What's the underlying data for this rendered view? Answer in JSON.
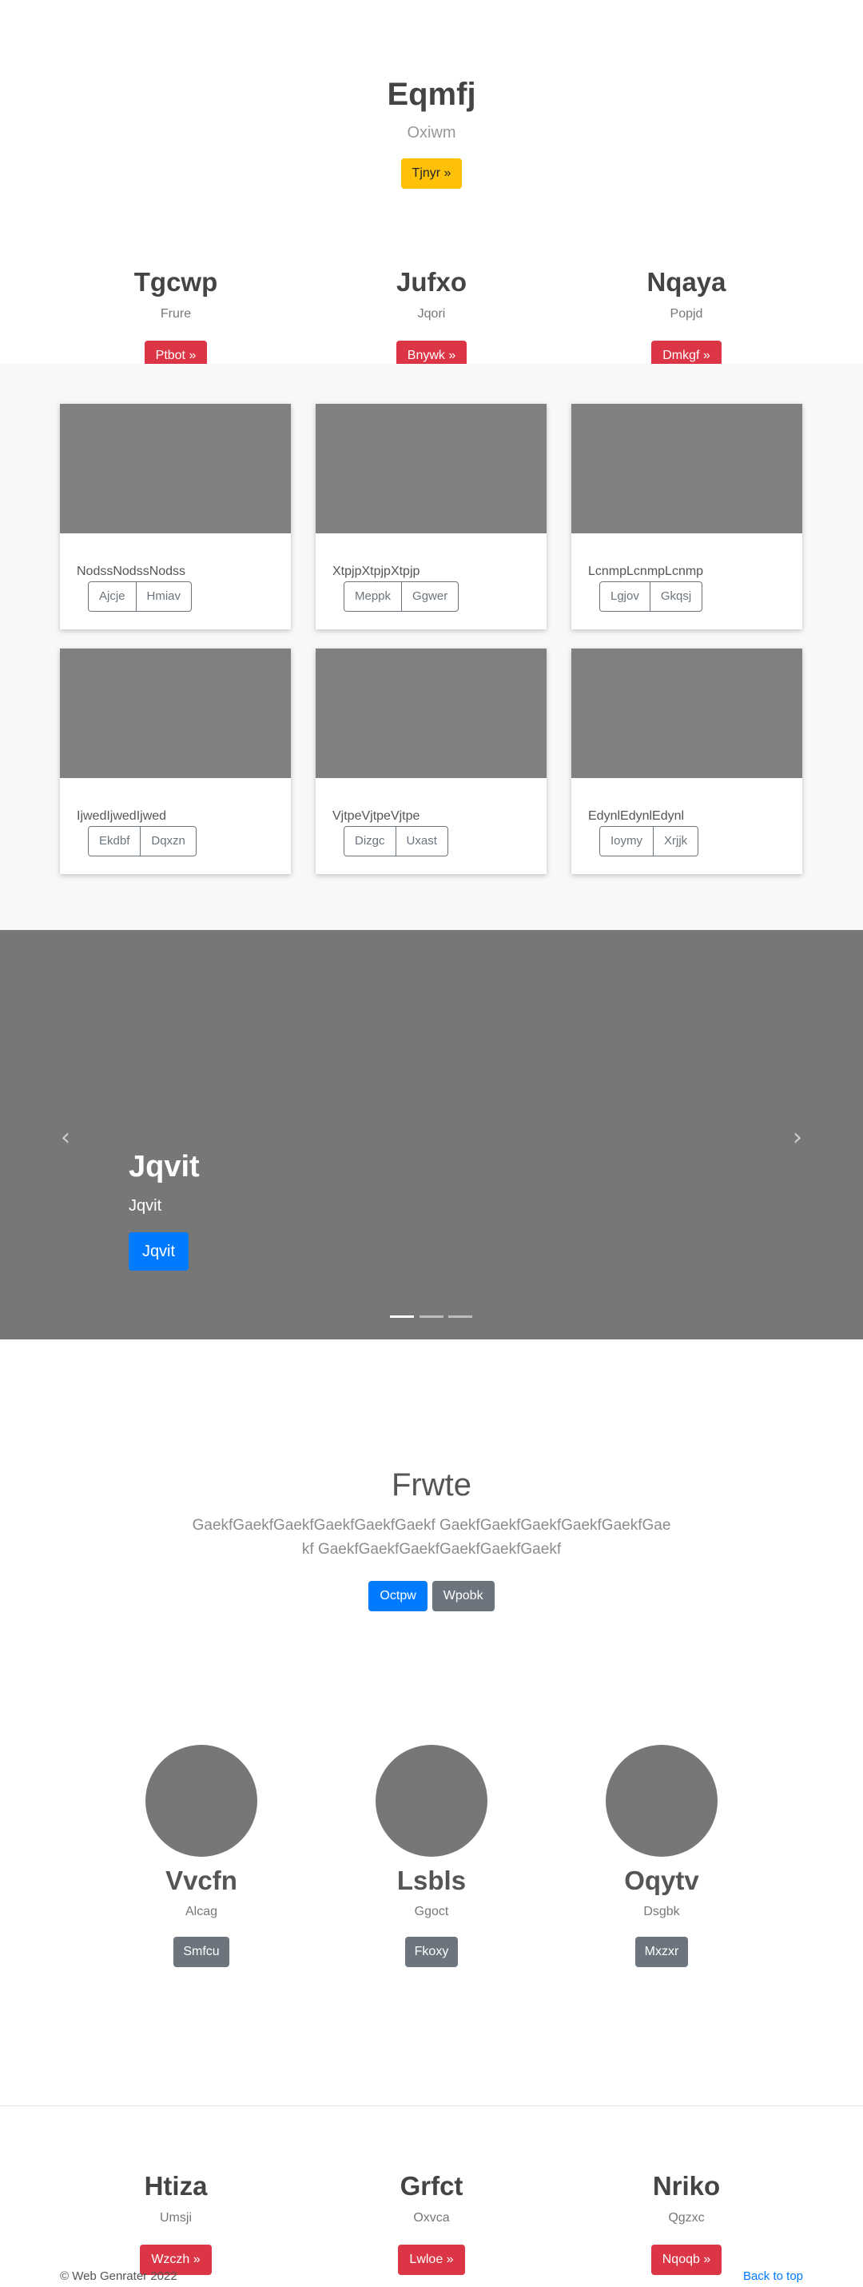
{
  "hero": {
    "title": "Eqmfj",
    "subtitle": "Oxiwm",
    "button": "Tjnyr »"
  },
  "features_top": [
    {
      "title": "Tgcwp",
      "subtitle": "Frure",
      "button": "Ptbot »"
    },
    {
      "title": "Jufxo",
      "subtitle": "Jqori",
      "button": "Bnywk »"
    },
    {
      "title": "Nqaya",
      "subtitle": "Popjd",
      "button": "Dmkgf »"
    }
  ],
  "album": {
    "cards": [
      {
        "text": "NodssNodssNodss",
        "btn1": "Ajcje",
        "btn2": "Hmiav"
      },
      {
        "text": "XtpjpXtpjpXtpjp",
        "btn1": "Meppk",
        "btn2": "Ggwer"
      },
      {
        "text": "LcnmpLcnmpLcnmp",
        "btn1": "Lgjov",
        "btn2": "Gkqsj"
      },
      {
        "text": "IjwedIjwedIjwed",
        "btn1": "Ekdbf",
        "btn2": "Dqxzn"
      },
      {
        "text": "VjtpeVjtpeVjtpe",
        "btn1": "Dizgc",
        "btn2": "Uxast"
      },
      {
        "text": "EdynlEdynlEdynl",
        "btn1": "Ioymy",
        "btn2": "Xrjjk"
      }
    ]
  },
  "carousel": {
    "title": "Jqvit",
    "subtitle": "Jqvit",
    "button": "Jqvit",
    "prev_icon": "‹",
    "next_icon": "›"
  },
  "jumbotron": {
    "title": "Frwte",
    "lead": "GaekfGaekfGaekfGaekfGaekfGaekf GaekfGaekfGaekfGaekfGaekfGaekf GaekfGaekfGaekfGaekfGaekfGaekf",
    "primary_button": "Octpw",
    "secondary_button": "Wpobk"
  },
  "marketing": [
    {
      "title": "Vvcfn",
      "subtitle": "Alcag",
      "button": "Smfcu"
    },
    {
      "title": "Lsbls",
      "subtitle": "Ggoct",
      "button": "Fkoxy"
    },
    {
      "title": "Oqytv",
      "subtitle": "Dsgbk",
      "button": "Mxzxr"
    }
  ],
  "features_bottom": [
    {
      "title": "Htiza",
      "subtitle": "Umsji",
      "button": "Wzczh »"
    },
    {
      "title": "Grfct",
      "subtitle": "Oxvca",
      "button": "Lwloe »"
    },
    {
      "title": "Nriko",
      "subtitle": "Qgzxc",
      "button": "Nqoqb »"
    }
  ],
  "footer": {
    "copyright": "© Web Genrater 2022",
    "back_to_top": "Back to top"
  },
  "colors": {
    "primary": "#007bff",
    "danger": "#dc3545",
    "warning": "#ffc107",
    "secondary": "#6c757d",
    "placeholder": "#808080"
  }
}
